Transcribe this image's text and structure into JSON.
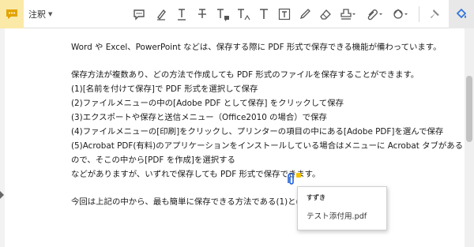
{
  "toolbar": {
    "menu_label": "注釈",
    "icons": [
      "comment-icon",
      "highlight-icon",
      "underline-icon",
      "strikethrough-icon",
      "replace-text-icon",
      "insert-text-icon",
      "add-text-icon",
      "text-box-icon",
      "pencil-icon",
      "eraser-icon",
      "stamp-icon",
      "attach-icon",
      "shapes-icon",
      "pin-icon",
      "fill-color-icon"
    ],
    "colors": {
      "badge": "#fbe9a8",
      "badge_icon": "#e2a400",
      "accent": "#2a6edb"
    }
  },
  "document": {
    "lines": [
      "Word や Excel、PowerPoint などは、保存する際に PDF 形式で保存できる機能が備わっています。",
      "保存方法が複数あり、どの方法で作成しても PDF 形式のファイルを保存することができます。",
      "(1)[名前を付けて保存]で PDF 形式を選択して保存",
      "(2)ファイルメニューの中の[Adobe PDF として保存] をクリックして保存",
      "(3)エクスポートや保存と送信メニュー（Office2010 の場合）で保存",
      "(4)ファイルメニューの[印刷]をクリックし、プリンターの項目の中にある[Adobe PDF]を選んで保存",
      "(5)Acrobat  PDF(有料)のアプリケーションをインストールしている場合はメニューに Acrobat タブがある",
      "ので、そこの中から[PDF を作成]を選択する",
      "などがありますが、いずれで保存しても PDF 形式で保存できます。",
      "今回は上記の中から、最も簡単に保存できる方法である(1)と(2)につい"
    ]
  },
  "attachment_popup": {
    "author": "すずき",
    "filename": "テスト添付用.pdf"
  }
}
